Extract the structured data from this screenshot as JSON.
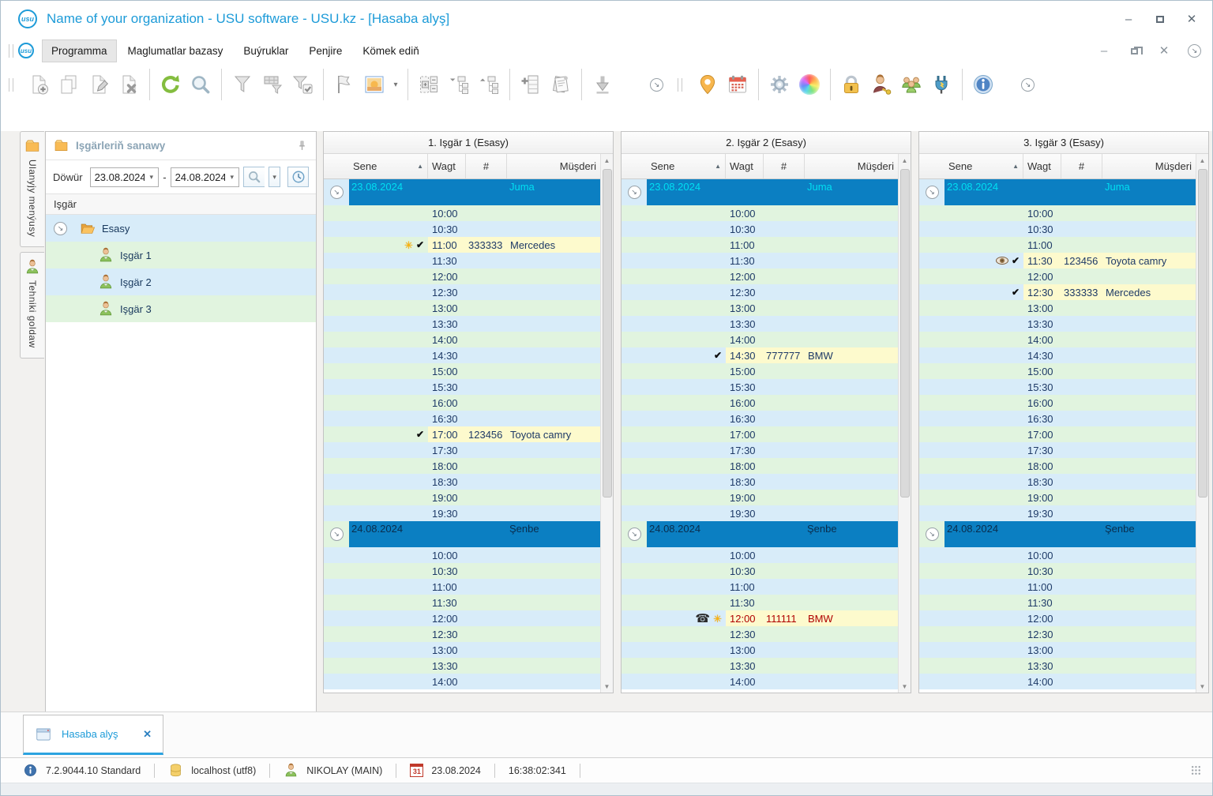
{
  "window": {
    "title": "Name of your organization - USU software - USU.kz - [Hasaba alyş]",
    "logo_text": "usu",
    "control_icons": [
      "minimize-icon",
      "maximize-icon",
      "close-icon"
    ]
  },
  "menubar": {
    "items": [
      {
        "label": "Programma",
        "active": true
      },
      {
        "label": "Maglumatlar bazasy",
        "active": false
      },
      {
        "label": "Buýruklar",
        "active": false
      },
      {
        "label": "Penjire",
        "active": false
      },
      {
        "label": "Kömek ediň",
        "active": false
      }
    ],
    "control_icons": [
      "minimize-icon",
      "restore-icon",
      "close-icon",
      "overflow-icon"
    ]
  },
  "toolbar": {
    "bands": [
      {
        "groups": [
          [
            "new-record-icon",
            "copy-record-icon",
            "edit-record-icon",
            "delete-record-icon"
          ],
          [
            "refresh-icon",
            "search-icon"
          ],
          [
            "filter-icon",
            "filter-columns-icon",
            "filter-check-icon"
          ],
          [
            "flag-icon",
            "image-picker-icon",
            "dropdown-icon"
          ],
          [
            "group-list-icon",
            "tree-expand-icon",
            "tree-collapse-icon"
          ],
          [
            "add-column-icon",
            "reports-icon"
          ],
          [
            "export-icon"
          ]
        ],
        "overflow_icon": "overflow-icon"
      },
      {
        "groups": [
          [
            "map-pin-icon",
            "calendar-icon"
          ],
          [
            "settings-icon",
            "palette-icon"
          ],
          [
            "lock-icon",
            "user-key-icon",
            "users-group-icon",
            "plug-icon"
          ],
          [
            "info-icon"
          ]
        ],
        "overflow_icon": "overflow-icon"
      }
    ]
  },
  "sidebar": {
    "tabs": [
      {
        "icon": "folder-icon",
        "label": "Ulanyjy menýusy"
      },
      {
        "icon": "person-icon",
        "label": "Tehniki goldaw"
      }
    ],
    "panel": {
      "title": "Işgärleriň sanawy",
      "title_icon": "folder-icon",
      "pin_icon": "pin-icon"
    },
    "period": {
      "label": "Döwür",
      "from": "23.08.2024",
      "dash": "-",
      "to": "24.08.2024",
      "buttons": [
        "search-icon",
        "dropdown-icon",
        "clock-icon"
      ]
    },
    "tree": {
      "header": "Işgär",
      "root": {
        "icon": "open-folder-icon",
        "expander_icon": "circle-arrow-icon",
        "label": "Esasy"
      },
      "employees": [
        {
          "icon": "person-icon",
          "label": "Işgär 1"
        },
        {
          "icon": "person-icon",
          "label": "Işgär 2"
        },
        {
          "icon": "person-icon",
          "label": "Işgär 3"
        }
      ]
    }
  },
  "schedule": {
    "columns": {
      "sene": "Sene",
      "wagt": "Wagt",
      "num": "#",
      "musderi": "Müşderi",
      "sort_icon": "sort-asc-icon"
    },
    "day1_times": [
      "10:00",
      "10:30",
      "11:00",
      "11:30",
      "12:00",
      "12:30",
      "13:00",
      "13:30",
      "14:00",
      "14:30",
      "15:00",
      "15:30",
      "16:00",
      "16:30",
      "17:00",
      "17:30",
      "18:00",
      "18:30",
      "19:00",
      "19:30"
    ],
    "day2_times": [
      "10:00",
      "10:30",
      "11:00",
      "11:30",
      "12:00",
      "12:30",
      "13:00",
      "13:30",
      "14:00"
    ],
    "panels": [
      {
        "title": "1. Işgär 1 (Esasy)",
        "days": [
          {
            "date": "23.08.2024",
            "weekday": "Juma",
            "date_text_style": "cyan",
            "times_ref": "day1_times",
            "appointments": [
              {
                "time": "11:00",
                "num": "333333",
                "client": "Mercedes",
                "icons": [
                  "busy-icon",
                  "check-icon"
                ]
              },
              {
                "time": "17:00",
                "num": "123456",
                "client": "Toyota camry",
                "icons": [
                  "check-icon"
                ]
              }
            ]
          },
          {
            "date": "24.08.2024",
            "weekday": "Şenbe",
            "date_text_style": "dark",
            "times_ref": "day2_times",
            "appointments": []
          }
        ]
      },
      {
        "title": "2. Işgär 2 (Esasy)",
        "days": [
          {
            "date": "23.08.2024",
            "weekday": "Juma",
            "date_text_style": "cyan",
            "times_ref": "day1_times",
            "appointments": [
              {
                "time": "14:30",
                "num": "777777",
                "client": "BMW",
                "icons": [
                  "check-icon"
                ]
              }
            ]
          },
          {
            "date": "24.08.2024",
            "weekday": "Şenbe",
            "date_text_style": "dark",
            "times_ref": "day2_times",
            "appointments": [
              {
                "time": "12:00",
                "num": "111111",
                "client": "BMW",
                "icons": [
                  "phone-icon",
                  "busy-icon"
                ],
                "style": "red"
              }
            ]
          }
        ]
      },
      {
        "title": "3. Işgär 3 (Esasy)",
        "days": [
          {
            "date": "23.08.2024",
            "weekday": "Juma",
            "date_text_style": "cyan",
            "times_ref": "day1_times",
            "appointments": [
              {
                "time": "11:30",
                "num": "123456",
                "client": "Toyota camry",
                "icons": [
                  "eye-icon",
                  "check-icon"
                ]
              },
              {
                "time": "12:30",
                "num": "333333",
                "client": "Mercedes",
                "icons": [
                  "check-icon"
                ]
              }
            ]
          },
          {
            "date": "24.08.2024",
            "weekday": "Şenbe",
            "date_text_style": "dark",
            "times_ref": "day2_times",
            "appointments": []
          }
        ]
      }
    ]
  },
  "bottom_tab": {
    "icon": "window-icon",
    "label": "Hasaba alyş",
    "close_icon": "close-icon",
    "close_glyph": "✕"
  },
  "statusbar": {
    "items": [
      {
        "icon": "info-badge-icon",
        "text": "7.2.9044.10 Standard"
      },
      {
        "icon": "database-icon",
        "text": "localhost (utf8)"
      },
      {
        "icon": "person-icon",
        "text": "NIKOLAY (MAIN)"
      },
      {
        "icon": "calendar-31-icon",
        "icon_text": "31",
        "text": "23.08.2024"
      },
      {
        "icon": "",
        "text": "16:38:02:341"
      }
    ]
  },
  "colors": {
    "stripe_blue": "#d8ecf9",
    "stripe_green": "#e1f4df",
    "appt_yellow": "#fdfacd",
    "group_blue": "#0b7fc2",
    "date_cyan": "#00dff2",
    "date_dark": "#0a2d4d",
    "text_navy": "#1e3a67",
    "text_red": "#b00000",
    "title_blue": "#1d9bd8"
  }
}
